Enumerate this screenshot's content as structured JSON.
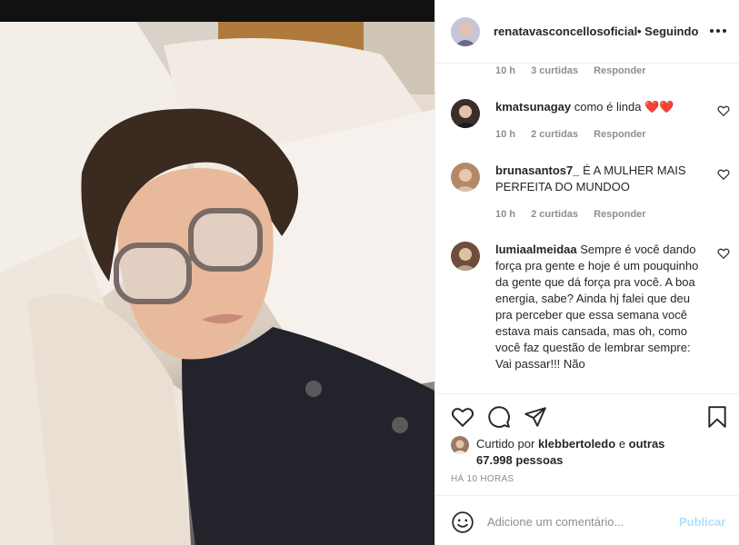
{
  "post": {
    "username": "renatavasconcellosoficial",
    "following_label": "• Seguindo",
    "more_icon": "more-horizontal-icon"
  },
  "first_meta": {
    "time": "10 h",
    "likes": "3 curtidas",
    "reply": "Responder"
  },
  "comments": [
    {
      "username": "kmatsunagay",
      "text": "como é linda ❤️❤️",
      "time": "10 h",
      "likes": "2 curtidas",
      "reply": "Responder"
    },
    {
      "username": "brunasantos7_",
      "text": "É A MULHER MAIS PERFEITA DO MUNDOO",
      "time": "10 h",
      "likes": "2 curtidas",
      "reply": "Responder"
    },
    {
      "username": "lumiaalmeidaa",
      "text": "Sempre é você dando força pra gente e hoje é um pouquinho da gente que dá força pra você. A boa energia, sabe? Ainda hj falei que deu pra perceber que essa semana você estava mais cansada, mas oh, como você faz questão de lembrar sempre: Vai passar!!! Não"
    }
  ],
  "likes": {
    "prefix": "Curtido por",
    "user": "klebbertoledo",
    "middle": "e",
    "others": "outras 67.998 pessoas"
  },
  "timestamp": "HÁ 10 HORAS",
  "add_comment": {
    "placeholder": "Adicione um comentário...",
    "publish": "Publicar"
  },
  "colors": {
    "publish_disabled": "#b2dffc",
    "heart_red": "#ed4956",
    "muted": "#8e8e8e"
  }
}
